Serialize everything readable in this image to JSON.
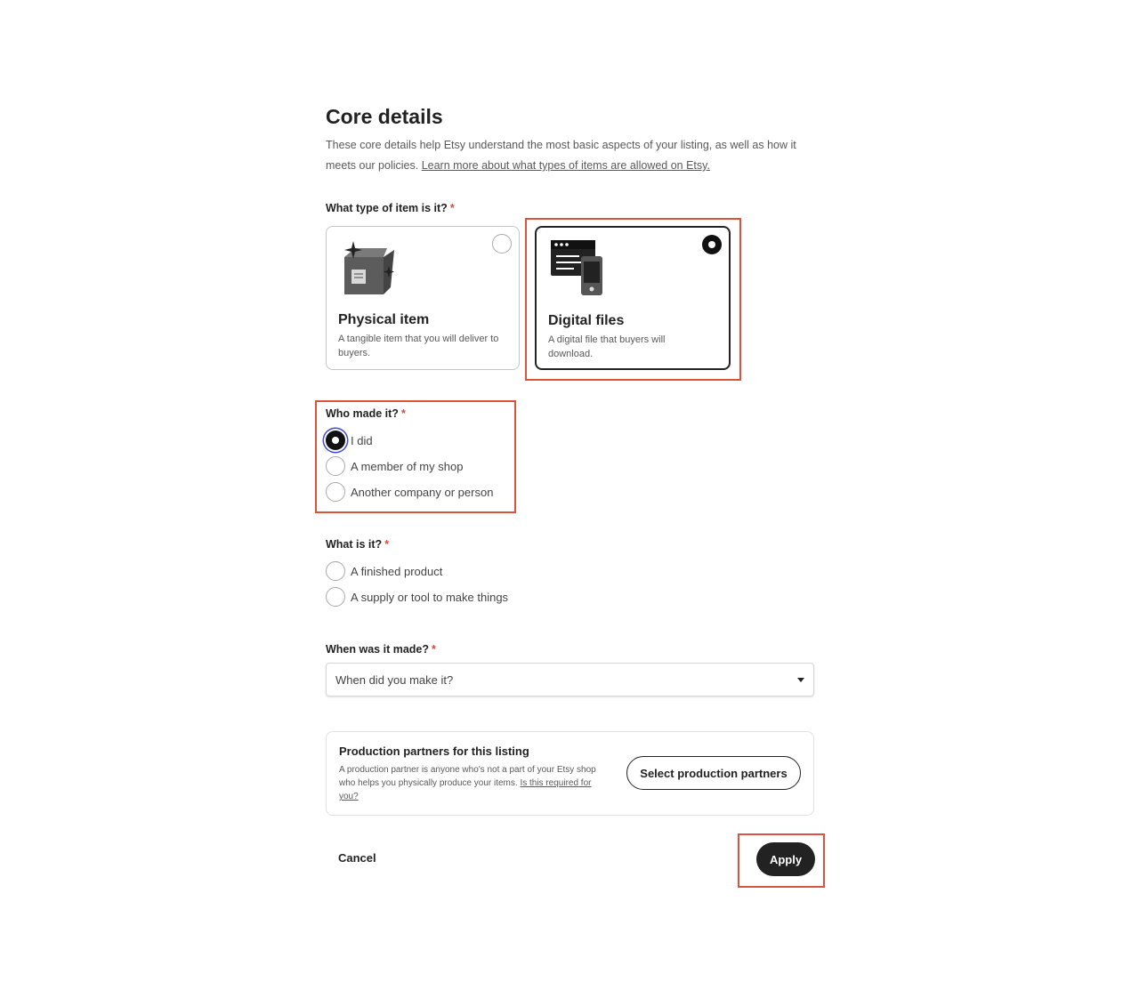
{
  "header": {
    "title": "Core details",
    "description": "These core details help Etsy understand the most basic aspects of your listing, as well as how it meets our policies. ",
    "learn_more_link": "Learn more about what types of items are allowed on Etsy."
  },
  "item_type": {
    "label": "What type of item is it?",
    "required_mark": "*",
    "options": [
      {
        "title": "Physical item",
        "description": "A tangible item that you will deliver to buyers.",
        "selected": false,
        "icon": "box-icon"
      },
      {
        "title": "Digital files",
        "description": "A digital file that buyers will download.",
        "selected": true,
        "icon": "digital-files-icon"
      }
    ]
  },
  "who_made": {
    "label": "Who made it?",
    "required_mark": "*",
    "options": [
      {
        "label": "I did",
        "selected": true
      },
      {
        "label": "A member of my shop",
        "selected": false
      },
      {
        "label": "Another company or person",
        "selected": false
      }
    ]
  },
  "what_is_it": {
    "label": "What is it?",
    "required_mark": "*",
    "options": [
      {
        "label": "A finished product",
        "selected": false
      },
      {
        "label": "A supply or tool to make things",
        "selected": false
      }
    ]
  },
  "when_made": {
    "label": "When was it made?",
    "required_mark": "*",
    "placeholder": "When did you make it?"
  },
  "production_partners": {
    "title": "Production partners for this listing",
    "description": "A production partner is anyone who's not a part of your Etsy shop who helps you physically produce your items. ",
    "link": "Is this required for you?",
    "button": "Select production partners"
  },
  "footer": {
    "cancel": "Cancel",
    "apply": "Apply"
  },
  "colors": {
    "highlight": "#d9533d",
    "required": "#d14a3b",
    "primary_button": "#222222",
    "focus_ring": "#3b4bd8"
  }
}
